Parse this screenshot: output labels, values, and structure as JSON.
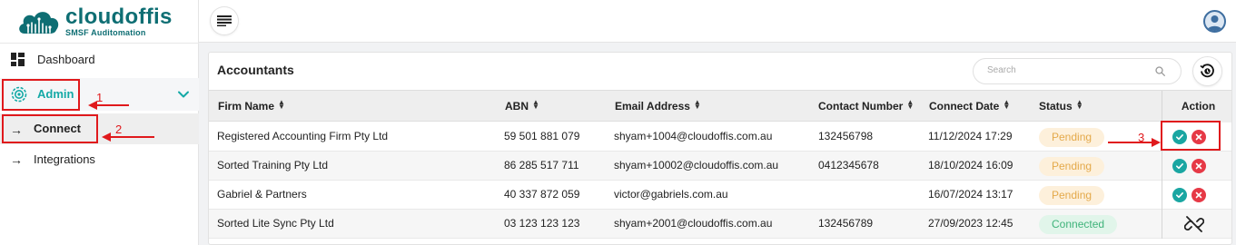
{
  "brand": {
    "name": "cloudoffis",
    "tagline": "SMSF Auditomation",
    "color": "#0e6e73"
  },
  "sidebar": {
    "items": [
      {
        "label": "Dashboard",
        "icon": "dashboard-grid-icon"
      },
      {
        "label": "Admin",
        "icon": "gear-icon",
        "expanded": true,
        "active": true
      },
      {
        "label": "Connect",
        "icon": "arrow-right-icon",
        "selected": true
      },
      {
        "label": "Integrations",
        "icon": "arrow-right-icon"
      }
    ]
  },
  "topbar": {
    "menu_icon": "hamburger-menu-icon",
    "avatar_icon": "user-avatar-icon"
  },
  "accountants": {
    "title": "Accountants",
    "search_placeholder": "Search",
    "columns": [
      "Firm Name",
      "ABN",
      "Email Address",
      "Contact Number",
      "Connect Date",
      "Status"
    ],
    "action_header": "Action",
    "rows": [
      {
        "firm": "Registered Accounting Firm Pty Ltd",
        "abn": "59 501 881 079",
        "email": "shyam+1004@cloudoffis.com.au",
        "contact": "132456798",
        "date": "11/12/2024 17:29",
        "status": "Pending"
      },
      {
        "firm": "Sorted Training Pty Ltd",
        "abn": "86 285 517 711",
        "email": "shyam+10002@cloudoffis.com.au",
        "contact": "0412345678",
        "date": "18/10/2024 16:09",
        "status": "Pending"
      },
      {
        "firm": "Gabriel & Partners",
        "abn": "40 337 872 059",
        "email": "victor@gabriels.com.au",
        "contact": "",
        "date": "16/07/2024 13:17",
        "status": "Pending"
      },
      {
        "firm": "Sorted Lite Sync Pty Ltd",
        "abn": "03 123 123 123",
        "email": "shyam+2001@cloudoffis.com.au",
        "contact": "132456789",
        "date": "27/09/2023 12:45",
        "status": "Connected"
      }
    ]
  },
  "annotations": {
    "one": "1",
    "two": "2",
    "three": "3"
  },
  "colors": {
    "accent": "#14a9a6",
    "annotation": "#e0191c",
    "pending": "#e4a94a",
    "connected": "#3fb37a",
    "reject": "#e63946"
  }
}
